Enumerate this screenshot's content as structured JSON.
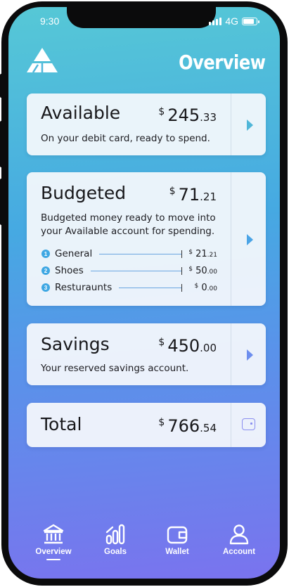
{
  "status": {
    "time": "9:30",
    "network": "4G"
  },
  "header": {
    "title": "Overview",
    "logo": "triangle-logo"
  },
  "cards": {
    "available": {
      "title": "Available",
      "currency": "$",
      "amount": "245",
      "cents": ".33",
      "desc": "On your debit card, ready to spend."
    },
    "budgeted": {
      "title": "Budgeted",
      "currency": "$",
      "amount": "71",
      "cents": ".21",
      "desc_line1": "Budgeted money ready to move into",
      "desc_line2": "your Available account for spending.",
      "items": [
        {
          "num": "1",
          "label": "General",
          "currency": "$",
          "amount": "21",
          "cents": ".21"
        },
        {
          "num": "2",
          "label": "Shoes",
          "currency": "$",
          "amount": "50",
          "cents": ".00"
        },
        {
          "num": "3",
          "label": "Resturaunts",
          "currency": "$",
          "amount": "0",
          "cents": ".00"
        }
      ]
    },
    "savings": {
      "title": "Savings",
      "currency": "$",
      "amount": "450",
      "cents": ".00",
      "desc": "Your reserved savings account."
    },
    "total": {
      "title": "Total",
      "currency": "$",
      "amount": "766",
      "cents": ".54"
    }
  },
  "nav": [
    {
      "label": "Overview",
      "icon": "bank-icon",
      "active": true
    },
    {
      "label": "Goals",
      "icon": "bar-chart-icon",
      "active": false
    },
    {
      "label": "Wallet",
      "icon": "wallet-icon",
      "active": false
    },
    {
      "label": "Account",
      "icon": "person-icon",
      "active": false
    }
  ],
  "colors": {
    "accent": "#4fb6d8",
    "accent2": "#8a8ef0",
    "gradient_top": "#56c8d6",
    "gradient_bottom": "#7a73ee"
  }
}
